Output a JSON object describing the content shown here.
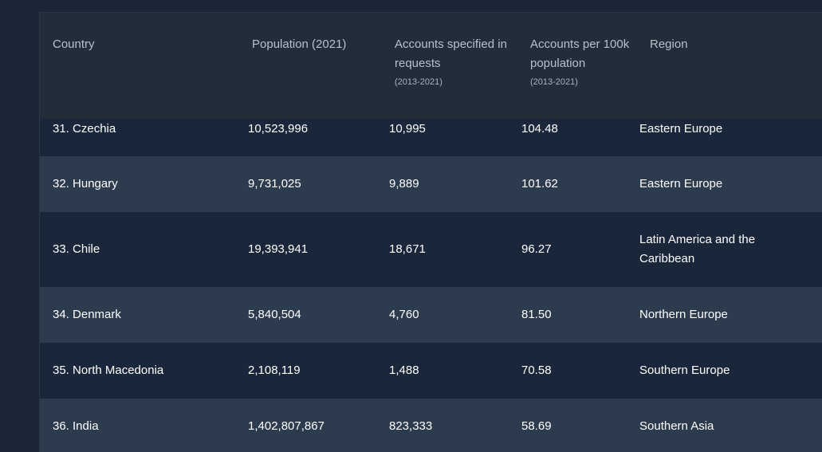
{
  "table": {
    "headers": {
      "country": "Country",
      "population": "Population (2021)",
      "accounts": "Accounts specified in requests",
      "accounts_sub": "(2013-2021)",
      "per100k": "Accounts per 100k population",
      "per100k_sub": "(2013-2021)",
      "region": "Region"
    },
    "rows": [
      {
        "country": "31. Czechia",
        "population": "10,523,996",
        "accounts": "10,995",
        "per100k": "104.48",
        "region": "Eastern Europe"
      },
      {
        "country": "32. Hungary",
        "population": "9,731,025",
        "accounts": "9,889",
        "per100k": "101.62",
        "region": "Eastern Europe"
      },
      {
        "country": "33. Chile",
        "population": "19,393,941",
        "accounts": "18,671",
        "per100k": "96.27",
        "region": "Latin America and the Caribbean"
      },
      {
        "country": "34. Denmark",
        "population": "5,840,504",
        "accounts": "4,760",
        "per100k": "81.50",
        "region": "Northern Europe"
      },
      {
        "country": "35. North Macedonia",
        "population": "2,108,119",
        "accounts": "1,488",
        "per100k": "70.58",
        "region": "Southern Europe"
      },
      {
        "country": "36. India",
        "population": "1,402,807,867",
        "accounts": "823,333",
        "per100k": "58.69",
        "region": "Southern Asia"
      }
    ]
  },
  "colors": {
    "page_bg": "#1b2638",
    "header_bg": "#222d3a",
    "row_dark": "#1a273b",
    "row_light": "#2d3b4f",
    "header_text": "#b9c0ca",
    "cell_text": "#ffffff"
  }
}
